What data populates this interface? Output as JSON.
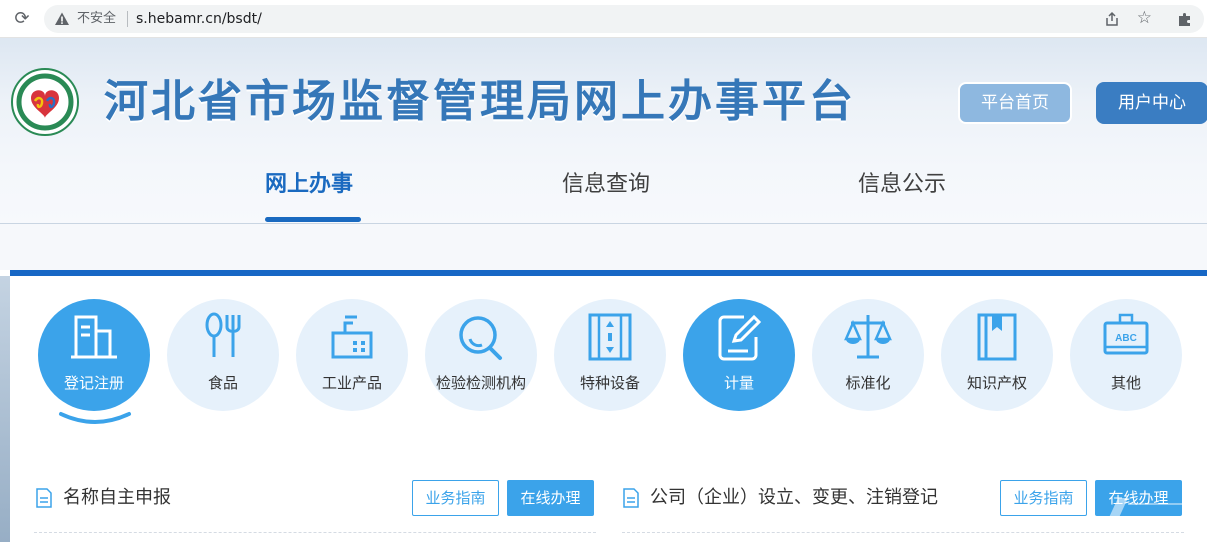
{
  "browser": {
    "reload_glyph": "⟳",
    "security_label": "不安全",
    "url": "s.hebamr.cn/bsdt/",
    "star_glyph": "☆"
  },
  "header": {
    "site_title": "河北省市场监督管理局网上办事平台",
    "home_button": "平台首页",
    "user_button": "用户中心",
    "nav_tabs": [
      {
        "label": "网上办事",
        "active": true
      },
      {
        "label": "信息查询",
        "active": false
      },
      {
        "label": "信息公示",
        "active": false
      }
    ]
  },
  "categories": [
    {
      "label": "登记注册",
      "icon": "building-icon",
      "active": true
    },
    {
      "label": "食品",
      "icon": "spoon-fork-icon",
      "active": false
    },
    {
      "label": "工业产品",
      "icon": "factory-icon",
      "active": false
    },
    {
      "label": "检验检测机构",
      "icon": "magnifier-icon",
      "active": false
    },
    {
      "label": "特种设备",
      "icon": "elevator-icon",
      "active": false
    },
    {
      "label": "计量",
      "icon": "edit-document-icon",
      "active": true
    },
    {
      "label": "标准化",
      "icon": "scale-icon",
      "active": false
    },
    {
      "label": "知识产权",
      "icon": "bookmark-book-icon",
      "active": false
    },
    {
      "label": "其他",
      "icon": "abc-badge-icon",
      "active": false
    }
  ],
  "services": [
    {
      "title": "名称自主申报",
      "guide_label": "业务指南",
      "online_label": "在线办理"
    },
    {
      "title": "公司（企业）设立、变更、注销登记",
      "guide_label": "业务指南",
      "online_label": "在线办理"
    }
  ],
  "colors": {
    "primary_blue": "#1767c5",
    "accent_blue": "#3ba3ea",
    "title_blue": "#3577b8"
  }
}
